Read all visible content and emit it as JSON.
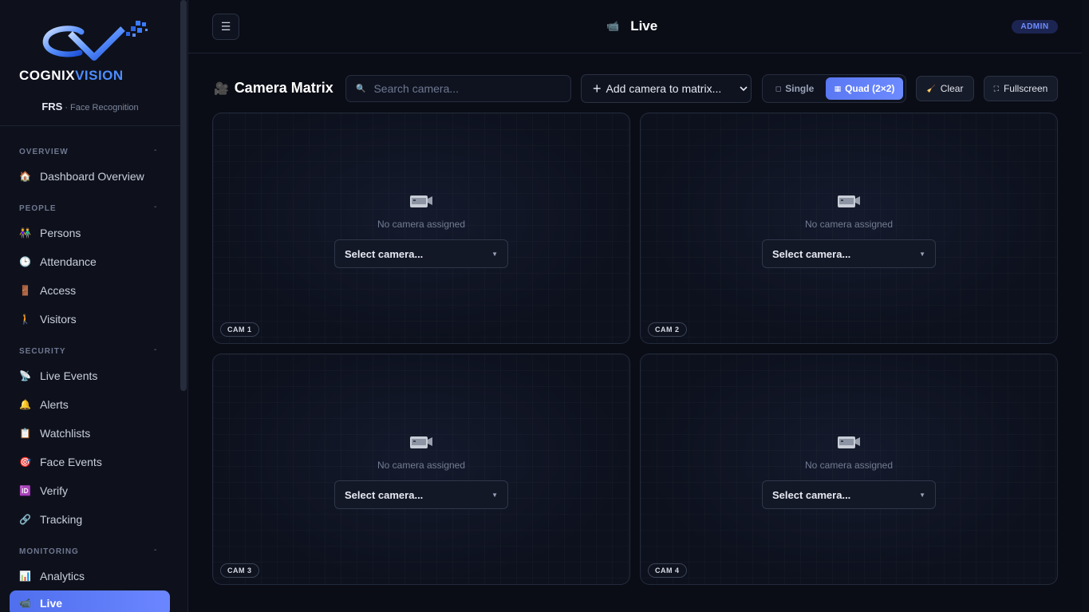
{
  "brand": {
    "logo_text_main": "COGNIX",
    "logo_text_accent": "VISION",
    "product": "FRS",
    "product_sub": "· Face Recognition"
  },
  "sidebar": {
    "sections": [
      {
        "label": "OVERVIEW",
        "caret": "-"
      },
      {
        "label": "PEOPLE",
        "caret": "-"
      },
      {
        "label": "SECURITY",
        "caret": "-"
      },
      {
        "label": "MONITORING",
        "caret": "-"
      }
    ],
    "items": [
      {
        "label": "Dashboard Overview",
        "icon": "🏠"
      },
      {
        "label": "Persons",
        "icon": "👫"
      },
      {
        "label": "Attendance",
        "icon": "🕒"
      },
      {
        "label": "Access",
        "icon": "🚪"
      },
      {
        "label": "Visitors",
        "icon": "🚶"
      },
      {
        "label": "Live Events",
        "icon": "📡"
      },
      {
        "label": "Alerts",
        "icon": "🔔"
      },
      {
        "label": "Watchlists",
        "icon": "📋"
      },
      {
        "label": "Face Events",
        "icon": "🎯"
      },
      {
        "label": "Verify",
        "icon": "🆔"
      },
      {
        "label": "Tracking",
        "icon": "🔗"
      },
      {
        "label": "Analytics",
        "icon": "📊"
      },
      {
        "label": "Live",
        "icon": "📹"
      }
    ]
  },
  "header": {
    "menu_icon": "☰",
    "title": "Live",
    "title_icon": "📹",
    "role_badge": "ADMIN"
  },
  "toolbar": {
    "title": "Camera Matrix",
    "title_icon": "🎥",
    "search_placeholder": "Search camera...",
    "search_icon": "🔍",
    "add_label": "Add camera to matrix...",
    "add_icon": "+",
    "single_label": "Single",
    "single_icon": "◻",
    "quad_label": "Quad (2×2)",
    "quad_icon": "▦",
    "clear_label": "Clear",
    "clear_icon": "🧹",
    "fullscreen_label": "Fullscreen",
    "fullscreen_icon": "⛶"
  },
  "cells": [
    {
      "badge": "CAM 1",
      "empty_text": "No camera assigned",
      "select_label": "Select camera..."
    },
    {
      "badge": "CAM 2",
      "empty_text": "No camera assigned",
      "select_label": "Select camera..."
    },
    {
      "badge": "CAM 3",
      "empty_text": "No camera assigned",
      "select_label": "Select camera..."
    },
    {
      "badge": "CAM 4",
      "empty_text": "No camera assigned",
      "select_label": "Select camera..."
    }
  ],
  "colors": {
    "accent": "#5a78f2",
    "background": "#0a0d16",
    "sidebar": "#0e111c"
  }
}
